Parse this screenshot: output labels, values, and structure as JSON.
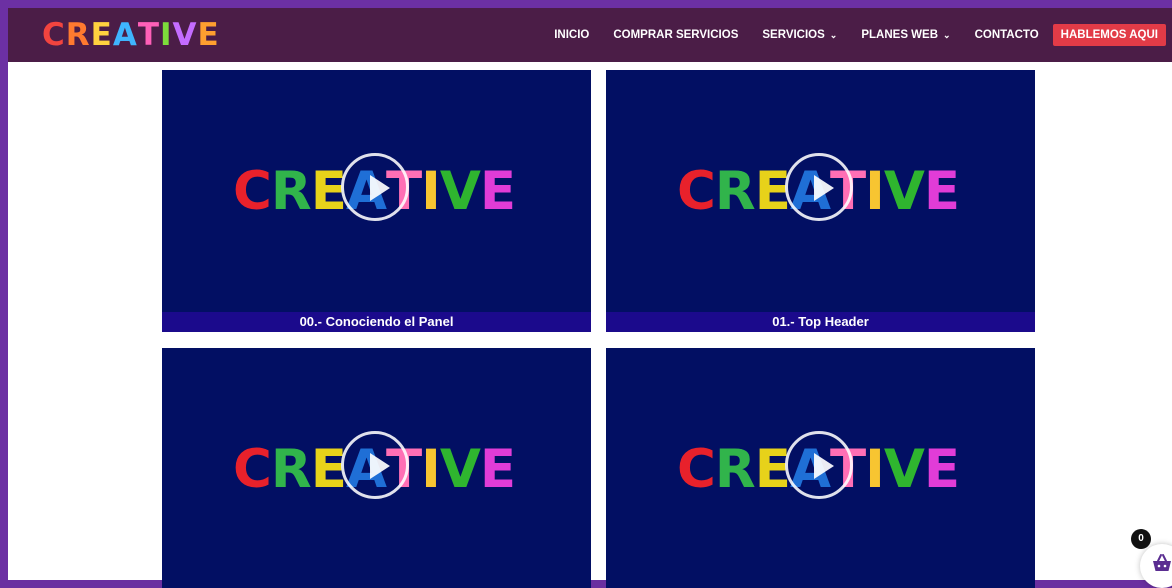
{
  "header": {
    "logo": {
      "letters": [
        "C",
        "R",
        "E",
        "A",
        "T",
        "I",
        "V",
        "E"
      ],
      "colors": [
        "#f2443f",
        "#ff7a2f",
        "#ffd23f",
        "#3fb5ff",
        "#ff5fb8",
        "#7ddc3b",
        "#c46cff",
        "#ff9f2f"
      ]
    },
    "nav": [
      {
        "label": "INICIO",
        "dropdown": false
      },
      {
        "label": "COMPRAR SERVICIOS",
        "dropdown": false
      },
      {
        "label": "SERVICIOS",
        "dropdown": true
      },
      {
        "label": "PLANES WEB",
        "dropdown": true
      },
      {
        "label": "CONTACTO",
        "dropdown": false
      }
    ],
    "cta_label": "HABLEMOS AQUI",
    "colors": {
      "bar": "#4b1d47",
      "cta": "#e23b47"
    }
  },
  "videos": [
    {
      "caption": "00.- Conociendo el Panel"
    },
    {
      "caption": "01.- Top Header"
    },
    {
      "caption": ""
    },
    {
      "caption": ""
    }
  ],
  "thumbnail_word": {
    "letters": [
      "C",
      "R",
      "E",
      "A",
      "T",
      "I",
      "V",
      "E"
    ],
    "colors": [
      "#e8212b",
      "#31b44b",
      "#e7d21a",
      "#1f6fd6",
      "#ff6fb5",
      "#f7c531",
      "#2fb52f",
      "#e13cd7"
    ]
  },
  "cart": {
    "count": "0",
    "icon": "shopping-basket-icon"
  }
}
